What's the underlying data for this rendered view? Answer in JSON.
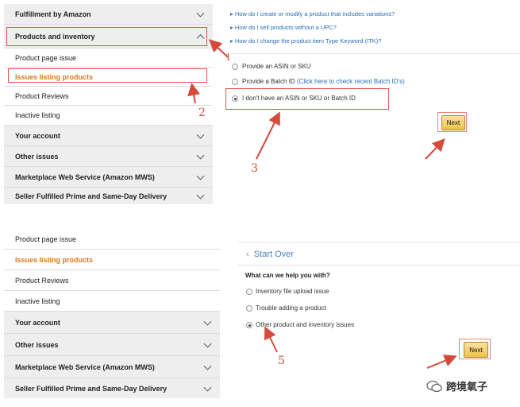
{
  "top_sidebar": {
    "items": [
      {
        "label": "Fulfillment by Amazon"
      },
      {
        "label": "Products and inventory"
      },
      {
        "label": "Product page issue"
      },
      {
        "label": "Issues listing products"
      },
      {
        "label": "Product Reviews"
      },
      {
        "label": "Inactive listing"
      },
      {
        "label": "Your account"
      },
      {
        "label": "Other issues"
      },
      {
        "label": "Marketplace Web Service (Amazon MWS)"
      },
      {
        "label": "Seller Fulfilled Prime and Same-Day Delivery"
      }
    ]
  },
  "top_panel": {
    "links": [
      "How do I create or modify a product that includes variations?",
      "How do I sell products without a UPC?",
      "How do I change the product item Type Keyword (ITK)?"
    ],
    "options": [
      "Provide an ASIN or SKU",
      "Provide a Batch ID",
      "I don't have an ASIN or SKU or Batch ID"
    ],
    "batch_link": "(Click here to check recent Batch ID's)",
    "next_label": "Next"
  },
  "annotations": {
    "n1": "1",
    "n2": "2",
    "n3": "3",
    "n5": "5"
  },
  "bottom_sidebar": {
    "items": [
      {
        "label": "Product page issue"
      },
      {
        "label": "Issues listing products"
      },
      {
        "label": "Product Reviews"
      },
      {
        "label": "Inactive listing"
      },
      {
        "label": "Your account"
      },
      {
        "label": "Other issues"
      },
      {
        "label": "Marketplace Web Service (Amazon MWS)"
      },
      {
        "label": "Seller Fulfilled Prime and Same-Day Delivery"
      }
    ]
  },
  "bottom_panel": {
    "start_over": "Start Over",
    "question": "What can we help you with?",
    "options": [
      "Inventory file upload issue",
      "Trouble adding a product",
      "Other product and inventory issues"
    ],
    "next_label": "Next"
  },
  "watermark": {
    "text": "跨境氧子"
  },
  "colors": {
    "accent_red": "#e0524d",
    "link_blue": "#2a6eb8",
    "orange": "#d97a1c",
    "button": "#f0c14b"
  }
}
